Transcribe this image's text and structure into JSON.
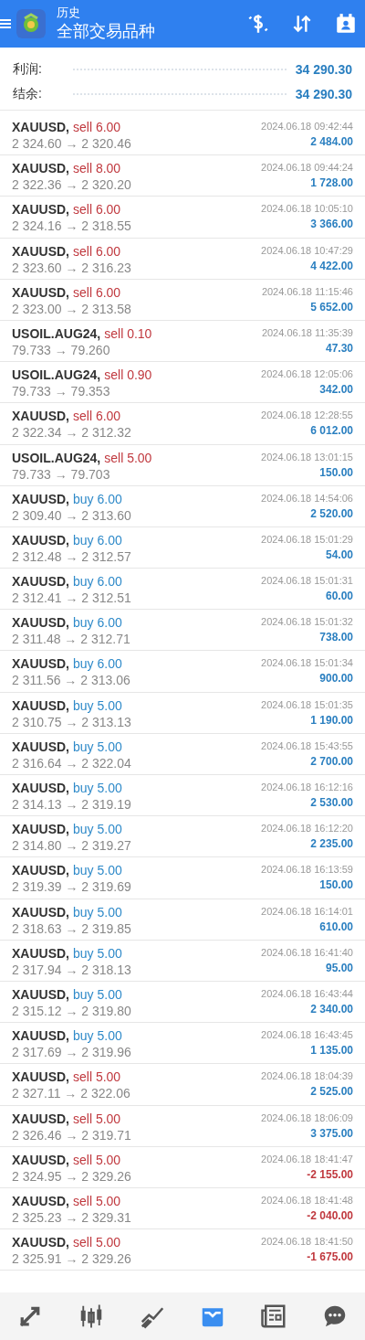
{
  "header": {
    "title": "历史",
    "subtitle": "全部交易品种"
  },
  "summary": [
    {
      "label": "利润:",
      "value": "34 290.30"
    },
    {
      "label": "结余:",
      "value": "34 290.30"
    }
  ],
  "trades": [
    {
      "symbol": "XAUUSD,",
      "order": "sell 6.00",
      "kind": "sell",
      "prices": "2 324.60 → 2 320.46",
      "time": "2024.06.18 09:42:44",
      "profit": "2 484.00",
      "negative": false
    },
    {
      "symbol": "XAUUSD,",
      "order": "sell 8.00",
      "kind": "sell",
      "prices": "2 322.36 → 2 320.20",
      "time": "2024.06.18 09:44:24",
      "profit": "1 728.00",
      "negative": false
    },
    {
      "symbol": "XAUUSD,",
      "order": "sell 6.00",
      "kind": "sell",
      "prices": "2 324.16 → 2 318.55",
      "time": "2024.06.18 10:05:10",
      "profit": "3 366.00",
      "negative": false
    },
    {
      "symbol": "XAUUSD,",
      "order": "sell 6.00",
      "kind": "sell",
      "prices": "2 323.60 → 2 316.23",
      "time": "2024.06.18 10:47:29",
      "profit": "4 422.00",
      "negative": false
    },
    {
      "symbol": "XAUUSD,",
      "order": "sell 6.00",
      "kind": "sell",
      "prices": "2 323.00 → 2 313.58",
      "time": "2024.06.18 11:15:46",
      "profit": "5 652.00",
      "negative": false
    },
    {
      "symbol": "USOIL.AUG24,",
      "order": "sell 0.10",
      "kind": "sell",
      "prices": "79.733 → 79.260",
      "time": "2024.06.18 11:35:39",
      "profit": "47.30",
      "negative": false
    },
    {
      "symbol": "USOIL.AUG24,",
      "order": "sell 0.90",
      "kind": "sell",
      "prices": "79.733 → 79.353",
      "time": "2024.06.18 12:05:06",
      "profit": "342.00",
      "negative": false
    },
    {
      "symbol": "XAUUSD,",
      "order": "sell 6.00",
      "kind": "sell",
      "prices": "2 322.34 → 2 312.32",
      "time": "2024.06.18 12:28:55",
      "profit": "6 012.00",
      "negative": false
    },
    {
      "symbol": "USOIL.AUG24,",
      "order": "sell 5.00",
      "kind": "sell",
      "prices": "79.733 → 79.703",
      "time": "2024.06.18 13:01:15",
      "profit": "150.00",
      "negative": false
    },
    {
      "symbol": "XAUUSD,",
      "order": "buy 6.00",
      "kind": "buy",
      "prices": "2 309.40 → 2 313.60",
      "time": "2024.06.18 14:54:06",
      "profit": "2 520.00",
      "negative": false
    },
    {
      "symbol": "XAUUSD,",
      "order": "buy 6.00",
      "kind": "buy",
      "prices": "2 312.48 → 2 312.57",
      "time": "2024.06.18 15:01:29",
      "profit": "54.00",
      "negative": false
    },
    {
      "symbol": "XAUUSD,",
      "order": "buy 6.00",
      "kind": "buy",
      "prices": "2 312.41 → 2 312.51",
      "time": "2024.06.18 15:01:31",
      "profit": "60.00",
      "negative": false
    },
    {
      "symbol": "XAUUSD,",
      "order": "buy 6.00",
      "kind": "buy",
      "prices": "2 311.48 → 2 312.71",
      "time": "2024.06.18 15:01:32",
      "profit": "738.00",
      "negative": false
    },
    {
      "symbol": "XAUUSD,",
      "order": "buy 6.00",
      "kind": "buy",
      "prices": "2 311.56 → 2 313.06",
      "time": "2024.06.18 15:01:34",
      "profit": "900.00",
      "negative": false
    },
    {
      "symbol": "XAUUSD,",
      "order": "buy 5.00",
      "kind": "buy",
      "prices": "2 310.75 → 2 313.13",
      "time": "2024.06.18 15:01:35",
      "profit": "1 190.00",
      "negative": false
    },
    {
      "symbol": "XAUUSD,",
      "order": "buy 5.00",
      "kind": "buy",
      "prices": "2 316.64 → 2 322.04",
      "time": "2024.06.18 15:43:55",
      "profit": "2 700.00",
      "negative": false
    },
    {
      "symbol": "XAUUSD,",
      "order": "buy 5.00",
      "kind": "buy",
      "prices": "2 314.13 → 2 319.19",
      "time": "2024.06.18 16:12:16",
      "profit": "2 530.00",
      "negative": false
    },
    {
      "symbol": "XAUUSD,",
      "order": "buy 5.00",
      "kind": "buy",
      "prices": "2 314.80 → 2 319.27",
      "time": "2024.06.18 16:12:20",
      "profit": "2 235.00",
      "negative": false
    },
    {
      "symbol": "XAUUSD,",
      "order": "buy 5.00",
      "kind": "buy",
      "prices": "2 319.39 → 2 319.69",
      "time": "2024.06.18 16:13:59",
      "profit": "150.00",
      "negative": false
    },
    {
      "symbol": "XAUUSD,",
      "order": "buy 5.00",
      "kind": "buy",
      "prices": "2 318.63 → 2 319.85",
      "time": "2024.06.18 16:14:01",
      "profit": "610.00",
      "negative": false
    },
    {
      "symbol": "XAUUSD,",
      "order": "buy 5.00",
      "kind": "buy",
      "prices": "2 317.94 → 2 318.13",
      "time": "2024.06.18 16:41:40",
      "profit": "95.00",
      "negative": false
    },
    {
      "symbol": "XAUUSD,",
      "order": "buy 5.00",
      "kind": "buy",
      "prices": "2 315.12 → 2 319.80",
      "time": "2024.06.18 16:43:44",
      "profit": "2 340.00",
      "negative": false
    },
    {
      "symbol": "XAUUSD,",
      "order": "buy 5.00",
      "kind": "buy",
      "prices": "2 317.69 → 2 319.96",
      "time": "2024.06.18 16:43:45",
      "profit": "1 135.00",
      "negative": false
    },
    {
      "symbol": "XAUUSD,",
      "order": "sell 5.00",
      "kind": "sell",
      "prices": "2 327.11 → 2 322.06",
      "time": "2024.06.18 18:04:39",
      "profit": "2 525.00",
      "negative": false
    },
    {
      "symbol": "XAUUSD,",
      "order": "sell 5.00",
      "kind": "sell",
      "prices": "2 326.46 → 2 319.71",
      "time": "2024.06.18 18:06:09",
      "profit": "3 375.00",
      "negative": false
    },
    {
      "symbol": "XAUUSD,",
      "order": "sell 5.00",
      "kind": "sell",
      "prices": "2 324.95 → 2 329.26",
      "time": "2024.06.18 18:41:47",
      "profit": "-2 155.00",
      "negative": true
    },
    {
      "symbol": "XAUUSD,",
      "order": "sell 5.00",
      "kind": "sell",
      "prices": "2 325.23 → 2 329.31",
      "time": "2024.06.18 18:41:48",
      "profit": "-2 040.00",
      "negative": true
    },
    {
      "symbol": "XAUUSD,",
      "order": "sell 5.00",
      "kind": "sell",
      "prices": "2 325.91 → 2 329.26",
      "time": "2024.06.18 18:41:50",
      "profit": "-1 675.00",
      "negative": true
    }
  ],
  "nav": [
    {
      "kind": "trade",
      "selected": false
    },
    {
      "kind": "quotes",
      "selected": false
    },
    {
      "kind": "chart",
      "selected": false
    },
    {
      "kind": "history",
      "selected": true
    },
    {
      "kind": "news",
      "selected": false
    },
    {
      "kind": "chat",
      "selected": false
    }
  ]
}
